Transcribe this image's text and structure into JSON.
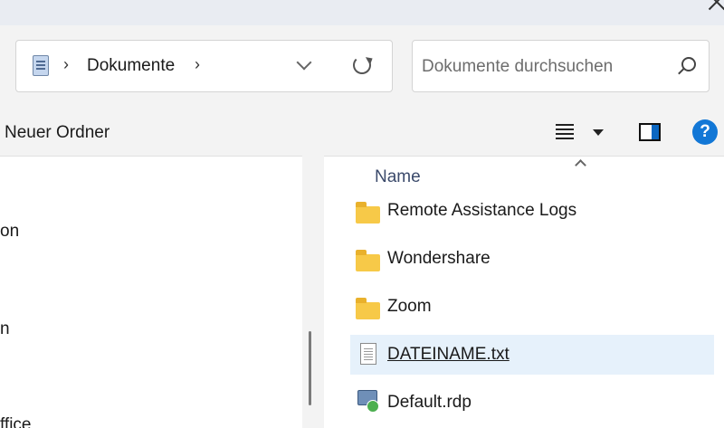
{
  "window": {
    "close_icon": "close-icon"
  },
  "address": {
    "folder_icon": "documents-icon",
    "location": "Dokumente",
    "sep_before": "›",
    "sep_after": "›",
    "dropdown_icon": "chevron-down-icon",
    "refresh_icon": "refresh-icon"
  },
  "search": {
    "placeholder": "Dokumente durchsuchen",
    "icon": "search-icon"
  },
  "toolbar": {
    "new_folder_label": "Neuer Ordner",
    "view_icon": "list-view-icon",
    "view_dropdown_icon": "caret-down-icon",
    "details_pane_icon": "details-pane-icon",
    "help_label": "?"
  },
  "nav_pane": {
    "items": [
      {
        "label": "on"
      },
      {
        "label": "n"
      },
      {
        "label": "ffice"
      }
    ]
  },
  "file_list": {
    "column_name": "Name",
    "sort_icon": "sort-ascending-icon",
    "items": [
      {
        "name": "Remote Assistance Logs",
        "type": "folder",
        "icon": "folder-icon"
      },
      {
        "name": "Wondershare",
        "type": "folder",
        "icon": "folder-icon"
      },
      {
        "name": "Zoom",
        "type": "folder",
        "icon": "folder-icon"
      },
      {
        "name": "DATEINAME.txt",
        "type": "text",
        "icon": "text-file-icon",
        "selected": true
      },
      {
        "name": "Default.rdp",
        "type": "rdp",
        "icon": "remote-desktop-file-icon"
      }
    ]
  },
  "colors": {
    "selection": "#e6f1fb",
    "folder": "#f7c948",
    "accent": "#0a67c2",
    "help": "#1277d6"
  }
}
